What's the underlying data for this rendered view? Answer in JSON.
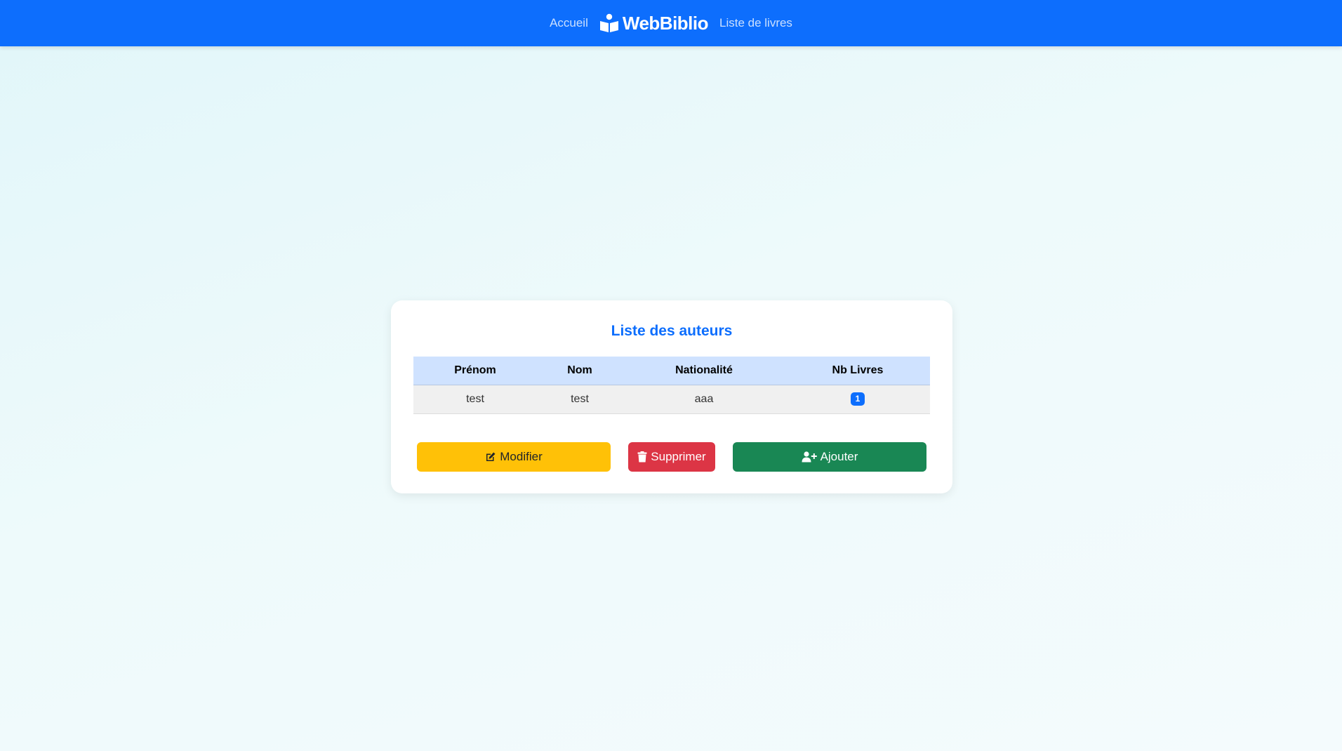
{
  "navbar": {
    "home_label": "Accueil",
    "brand_name": "WebBiblio",
    "books_label": "Liste de livres",
    "brand_icon": "book-reader-icon"
  },
  "card": {
    "title": "Liste des auteurs",
    "table": {
      "headers": [
        "Prénom",
        "Nom",
        "Nationalité",
        "Nb Livres"
      ],
      "rows": [
        {
          "prenom": "test",
          "nom": "test",
          "nationalite": "aaa",
          "nb_livres": "1"
        }
      ]
    },
    "actions": {
      "modify_label": "Modifier",
      "modify_icon": "edit-icon",
      "delete_label": "Supprimer",
      "delete_icon": "trash-icon",
      "add_label": "Ajouter",
      "add_icon": "user-plus-icon"
    }
  },
  "colors": {
    "primary": "#0d6efd",
    "warning": "#ffc107",
    "danger": "#dc3545",
    "success": "#198754",
    "table_header": "#cfe2ff"
  }
}
